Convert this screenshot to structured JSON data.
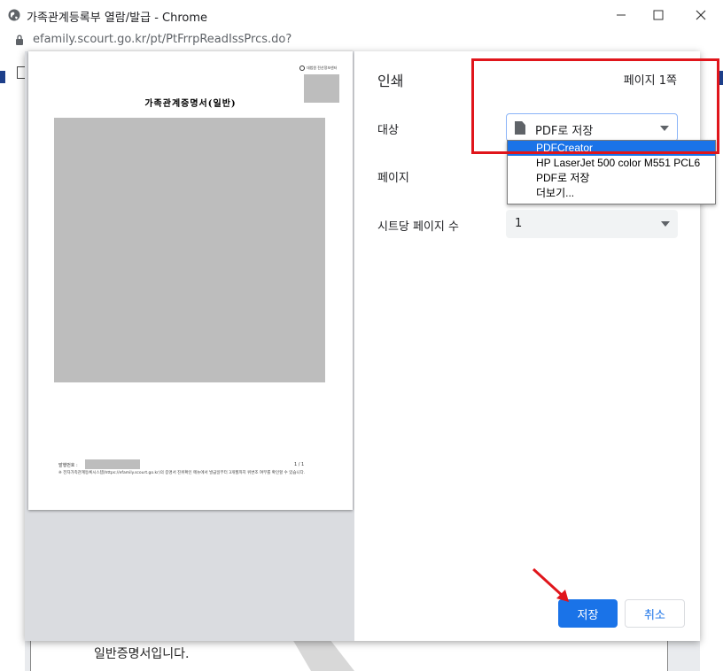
{
  "window": {
    "title": "가족관계등록부 열람/발급 - Chrome",
    "url": "efamily.scourt.go.kr/pt/PtFrrpReadIssPrcs.do?"
  },
  "background_page": {
    "text_line": "일반증명서입니다."
  },
  "preview": {
    "logo_text": "대법원 전산정보센터",
    "doc_title": "가족관계증명서(일반)",
    "footer_label": "발행번호 :",
    "footer_page": "1 / 1",
    "footer_note": "※ 전자가족관계등록시스템(https://efamily.scourt.go.kr)의 증명서 진위확인 메뉴에서 발급일부터 3개월까지 위변조 여부를 확인할 수 있습니다."
  },
  "print": {
    "title": "인쇄",
    "page_count": "페이지 1쪽",
    "destination_label": "대상",
    "destination_value": "PDF로 저장",
    "destination_options": [
      "PDFCreator",
      "HP LaserJet 500 color M551 PCL6",
      "PDF로 저장",
      "더보기..."
    ],
    "pages_label": "페이지",
    "sheets_label": "시트당 페이지 수",
    "sheets_value": "1",
    "save_button": "저장",
    "cancel_button": "취소"
  },
  "colors": {
    "accent": "#1a73e8",
    "annotation_red": "#e0151b",
    "preview_gray": "#bdbdbd"
  }
}
